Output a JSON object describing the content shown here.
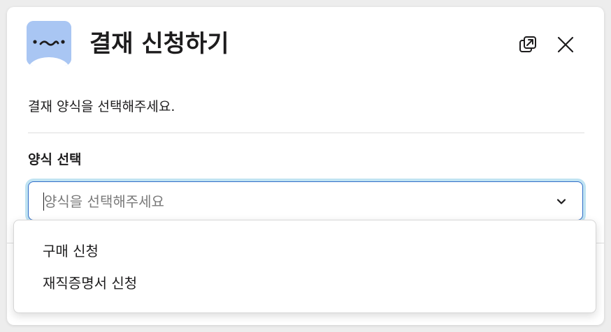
{
  "modal": {
    "title": "결재 신청하기",
    "app_icon": "sleepy-face-icon",
    "popout_icon": "popout-icon",
    "close_icon": "close-icon",
    "description": "결재 양식을 선택해주세요."
  },
  "form": {
    "label": "양식 선택",
    "select": {
      "placeholder": "양식을 선택해주세요",
      "chevron_icon": "chevron-down-icon"
    }
  },
  "dropdown": {
    "options": [
      {
        "label": "구매 신청"
      },
      {
        "label": "재직증명서 신청"
      }
    ]
  },
  "colors": {
    "icon_bg": "#a9c6f3",
    "focus_border": "#2f6cc8",
    "focus_ring": "#1d9bd1",
    "text": "#1d1c1d",
    "placeholder": "#7a7a7a"
  }
}
